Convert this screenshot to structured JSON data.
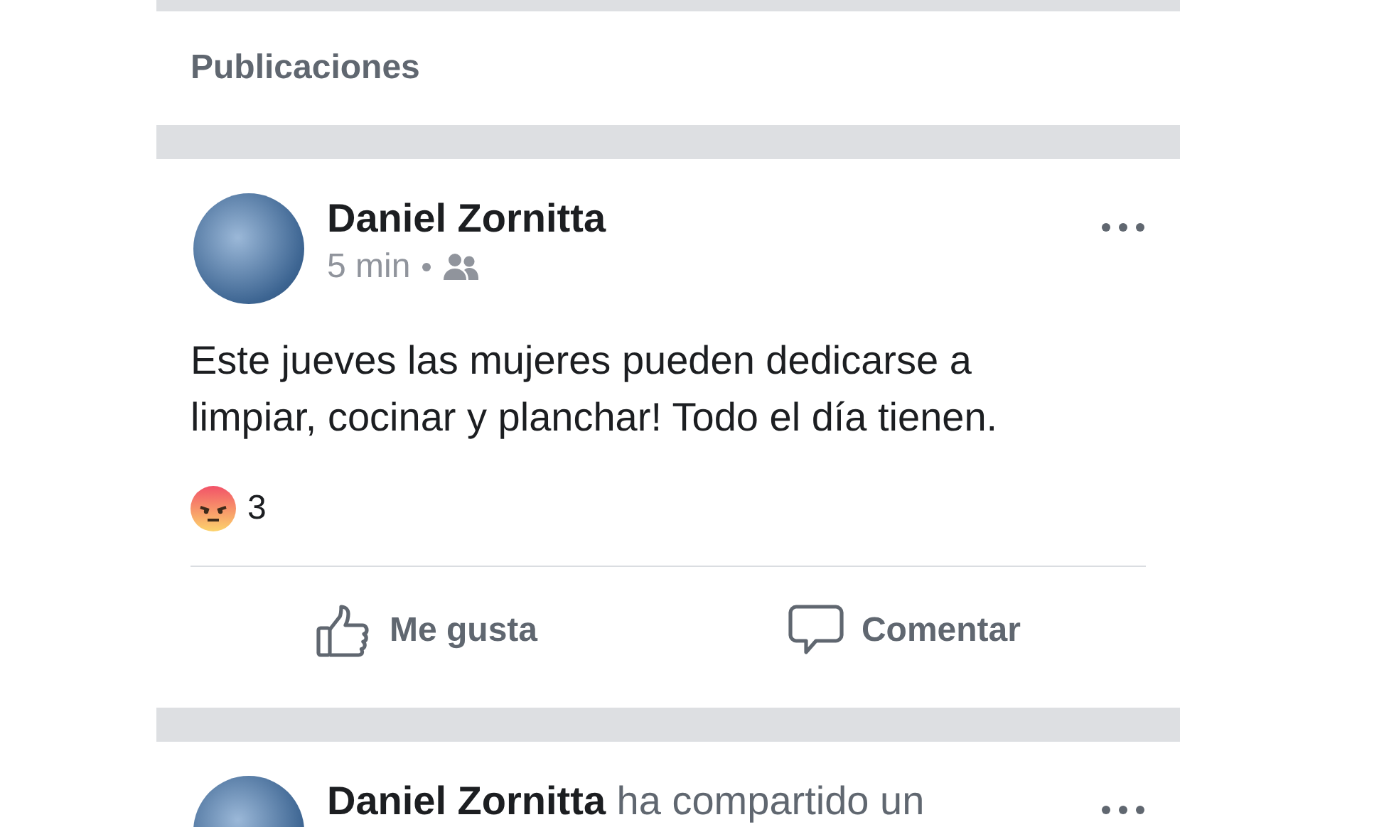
{
  "section_title": "Publicaciones",
  "posts": [
    {
      "kind": "status",
      "author": "Daniel Zornitta",
      "time": "5 min",
      "text": "Este jueves las mujeres pueden dedicarse a limpiar, cocinar y planchar! Todo el día tienen.",
      "reaction_count": "3",
      "actions": [
        {
          "kind": "like",
          "label": "Me gusta"
        },
        {
          "kind": "comment",
          "label": "Comentar"
        }
      ]
    },
    {
      "kind": "share",
      "heading": "**Daniel Zornitta** ha compartido un"
    }
  ]
}
